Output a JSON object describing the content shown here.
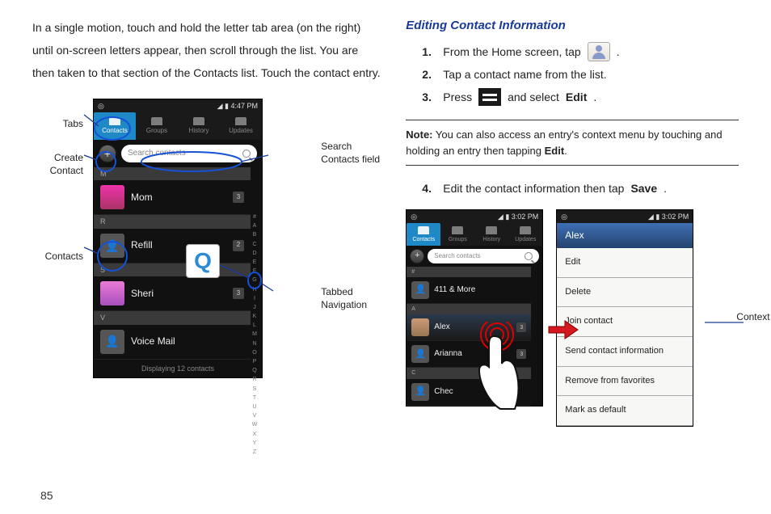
{
  "page_number": "85",
  "left_col": {
    "intro": "In a single motion, touch and hold the letter tab area (on the right) until on-screen letters appear, then scroll through the list. You are then taken to that section of the Contacts list. Touch the contact entry.",
    "labels": {
      "tabs": "Tabs",
      "create_contact": "Create Contact",
      "contacts": "Contacts",
      "search_field": "Search Contacts field",
      "tabbed_nav": "Tabbed Navigation"
    },
    "q_letter": "Q"
  },
  "right_col": {
    "heading": "Editing Contact Information",
    "steps": [
      {
        "num": "1.",
        "pre": "From the Home screen, tap",
        "post": "."
      },
      {
        "num": "2.",
        "text": "Tap a contact name from the list."
      },
      {
        "num": "3.",
        "pre": "Press",
        "mid": " and select ",
        "bold": "Edit",
        "post": "."
      }
    ],
    "note_label": "Note:",
    "note_text": " You can also access an entry's context menu by touching and holding an entry then tapping ",
    "note_bold": "Edit",
    "note_post": ".",
    "step4": {
      "num": "4.",
      "pre": "Edit the contact information then tap ",
      "bold": "Save",
      "post": "."
    },
    "ctx_label": "Context Menu"
  },
  "phone1": {
    "time": "4:47 PM",
    "tabs": {
      "contacts": "Contacts",
      "groups": "Groups",
      "history": "History",
      "updates": "Updates"
    },
    "search_placeholder": "Search contacts",
    "alpha": [
      "#",
      "A",
      "B",
      "C",
      "D",
      "E",
      "F",
      "G",
      "H",
      "I",
      "J",
      "K",
      "L",
      "M",
      "N",
      "O",
      "P",
      "Q",
      "R",
      "S",
      "T",
      "U",
      "V",
      "W",
      "X",
      "Y",
      "Z"
    ],
    "sep_m": "M",
    "sep_r": "R",
    "sep_s": "S",
    "sep_v": "V",
    "contacts": [
      {
        "name": "Mom",
        "cnt": "3"
      },
      {
        "name": "Refill",
        "cnt": "2"
      },
      {
        "name": "Sheri",
        "cnt": "3"
      },
      {
        "name": "Voice Mail",
        "cnt": ""
      }
    ],
    "footer": "Displaying 12 contacts"
  },
  "phone2": {
    "time": "3:02 PM",
    "tabs": {
      "contacts": "Contacts",
      "groups": "Groups",
      "history": "History",
      "updates": "Updates"
    },
    "search_placeholder": "Search contacts",
    "sep_num": "#",
    "sep_a": "A",
    "sep_c": "C",
    "contacts": [
      {
        "name": "411 & More",
        "cnt": ""
      },
      {
        "name": "Alex",
        "cnt": "3"
      },
      {
        "name": "Arianna",
        "cnt": "3"
      },
      {
        "name": "Chec",
        "cnt": ""
      }
    ]
  },
  "phone3": {
    "time": "3:02 PM",
    "header": "Alex",
    "items": [
      "Edit",
      "Delete",
      "Join contact",
      "Send contact information",
      "Remove from favorites",
      "Mark as default"
    ]
  }
}
